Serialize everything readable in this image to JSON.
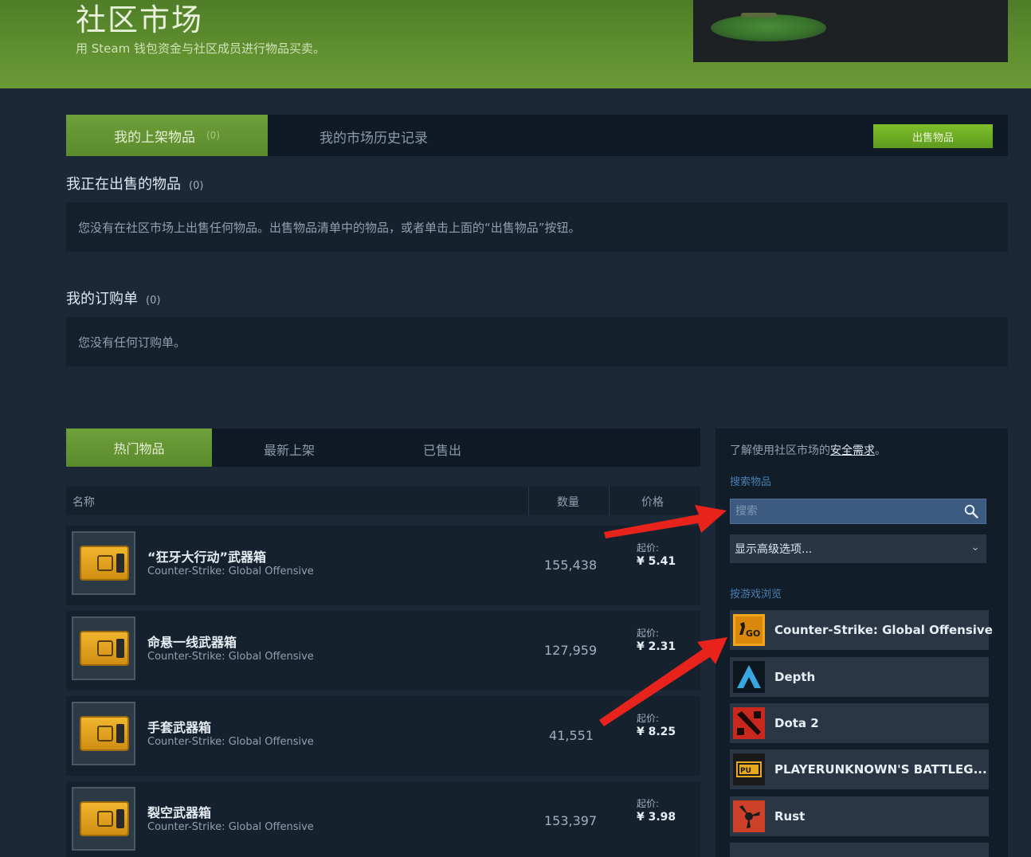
{
  "header": {
    "title": "社区市场",
    "subtitle": "用 Steam 钱包资金与社区成员进行物品买卖。"
  },
  "tabs": {
    "listings_label": "我的上架物品",
    "listings_count": "(0)",
    "history_label": "我的市场历史记录",
    "sell_button": "出售物品"
  },
  "selling": {
    "title": "我正在出售的物品",
    "count": "(0)",
    "empty": "您没有在社区市场上出售任何物品。出售物品清单中的物品，或者单击上面的“出售物品”按钮。"
  },
  "orders": {
    "title": "我的订购单",
    "count": "(0)",
    "empty": "您没有任何订购单。"
  },
  "popular_tabs": [
    "热门物品",
    "最新上架",
    "已售出"
  ],
  "table": {
    "col_name": "名称",
    "col_qty": "数量",
    "col_price": "价格",
    "price_prefix": "起价:",
    "rows": [
      {
        "name": "“狂牙大行动”武器箱",
        "game": "Counter-Strike: Global Offensive",
        "qty": "155,438",
        "price": "¥ 5.41"
      },
      {
        "name": "命悬一线武器箱",
        "game": "Counter-Strike: Global Offensive",
        "qty": "127,959",
        "price": "¥ 2.31"
      },
      {
        "name": "手套武器箱",
        "game": "Counter-Strike: Global Offensive",
        "qty": "41,551",
        "price": "¥ 8.25"
      },
      {
        "name": "裂空武器箱",
        "game": "Counter-Strike: Global Offensive",
        "qty": "153,397",
        "price": "¥ 3.98"
      }
    ]
  },
  "sidebar": {
    "safety_text": "了解使用社区市场的",
    "safety_link": "安全需求",
    "safety_end": "。",
    "search_label": "搜索物品",
    "search_placeholder": "搜索",
    "advanced": "显示高级选项...",
    "browse_label": "按游戏浏览",
    "games": [
      {
        "name": "Counter-Strike: Global Offensive",
        "icon": "csgo-icon"
      },
      {
        "name": "Depth",
        "icon": "depth-icon"
      },
      {
        "name": "Dota 2",
        "icon": "dota2-icon"
      },
      {
        "name": "PLAYERUNKNOWN'S BATTLEG...",
        "icon": "pubg-icon"
      },
      {
        "name": "Rust",
        "icon": "rust-icon"
      }
    ]
  },
  "colors": {
    "accent_green": "#6fa03a",
    "page_bg": "#1b2838",
    "annotation_red": "#e8231c"
  }
}
